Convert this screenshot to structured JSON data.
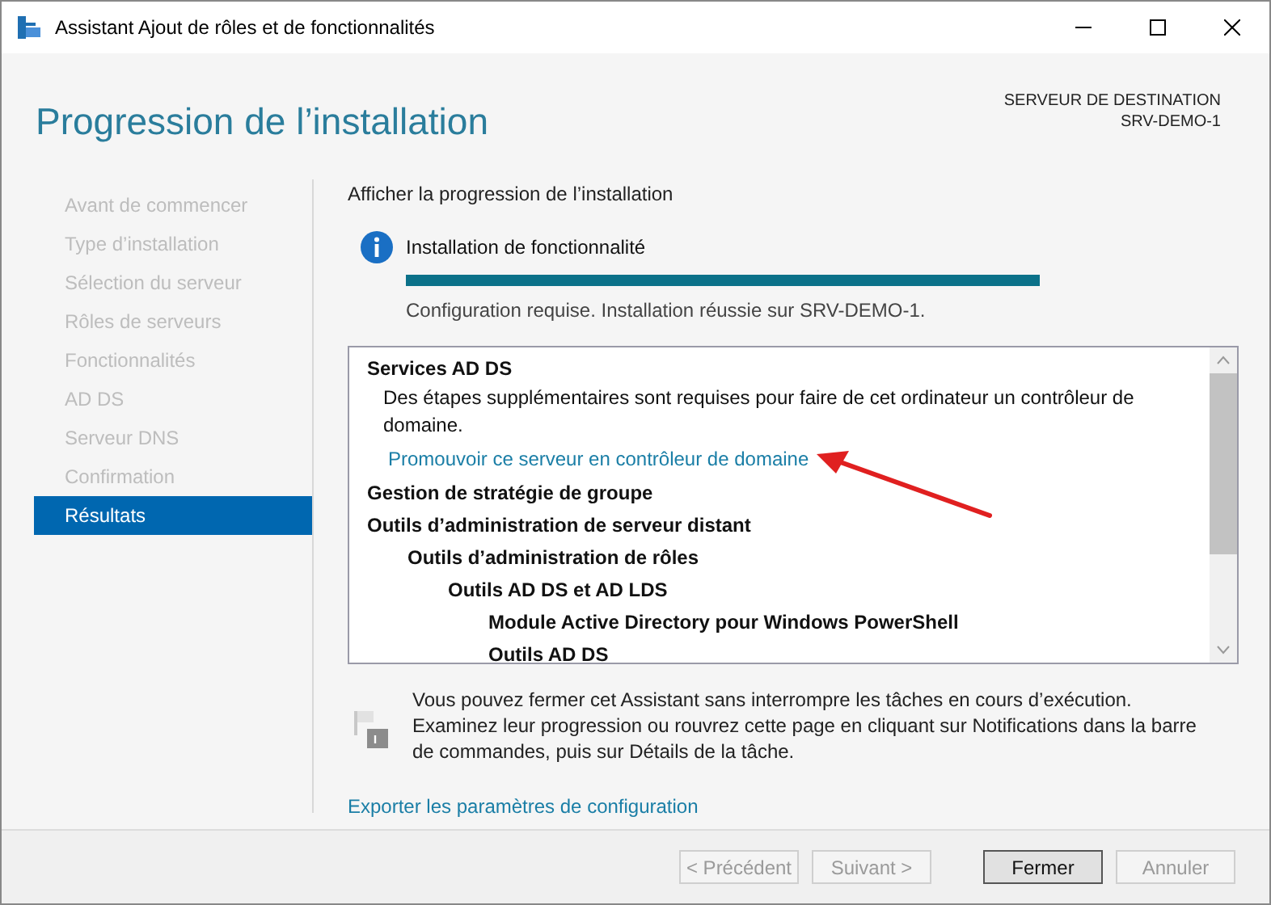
{
  "window": {
    "title": "Assistant Ajout de rôles et de fonctionnalités"
  },
  "header": {
    "title": "Progression de l’installation",
    "destination_label": "SERVEUR DE DESTINATION",
    "destination_server": "SRV-DEMO-1"
  },
  "steps": [
    {
      "label": "Avant de commencer",
      "selected": false,
      "disabled": true
    },
    {
      "label": "Type d’installation",
      "selected": false,
      "disabled": true
    },
    {
      "label": "Sélection du serveur",
      "selected": false,
      "disabled": true
    },
    {
      "label": "Rôles de serveurs",
      "selected": false,
      "disabled": true
    },
    {
      "label": "Fonctionnalités",
      "selected": false,
      "disabled": true
    },
    {
      "label": "AD DS",
      "selected": false,
      "disabled": true
    },
    {
      "label": "Serveur DNS",
      "selected": false,
      "disabled": true
    },
    {
      "label": "Confirmation",
      "selected": false,
      "disabled": true
    },
    {
      "label": "Résultats",
      "selected": true,
      "disabled": false
    }
  ],
  "content": {
    "heading": "Afficher la progression de l’installation",
    "status": {
      "title": "Installation de fonctionnalité",
      "level": 1,
      "message": "Configuration requise. Installation réussie sur SRV-DEMO-1."
    },
    "results": [
      {
        "kind": "feature",
        "label": "Services AD DS",
        "children": [
          {
            "kind": "message",
            "label": "Des étapes supplémentaires sont requises pour faire de cet ordinateur un contrôleur de domaine."
          },
          {
            "kind": "link",
            "label": "Promouvoir ce serveur en contrôleur de domaine"
          }
        ]
      },
      {
        "kind": "feature",
        "label": "Gestion de stratégie de groupe"
      },
      {
        "kind": "feature",
        "label": "Outils d’administration de serveur distant",
        "children": [
          {
            "kind": "feature",
            "label": "Outils d’administration de rôles",
            "children": [
              {
                "kind": "feature",
                "label": "Outils AD DS et AD LDS",
                "children": [
                  {
                    "kind": "feature",
                    "label": "Module Active Directory pour Windows PowerShell"
                  },
                  {
                    "kind": "feature",
                    "label": "Outils AD DS"
                  }
                ]
              }
            ]
          }
        ]
      }
    ],
    "notice": "Vous pouvez fermer cet Assistant sans interrompre les tâches en cours d’exécution. Examinez leur progression ou rouvrez cette page en cliquant sur Notifications dans la barre de commandes, puis sur Détails de la tâche.",
    "export_link": "Exporter les paramètres de configuration"
  },
  "buttons": [
    {
      "label": "< Précédent",
      "disabled": true,
      "default": false
    },
    {
      "label": "Suivant >",
      "disabled": true,
      "default": false
    },
    {
      "label": "Fermer",
      "disabled": false,
      "default": true
    },
    {
      "label": "Annuler",
      "disabled": true,
      "default": false
    }
  ]
}
